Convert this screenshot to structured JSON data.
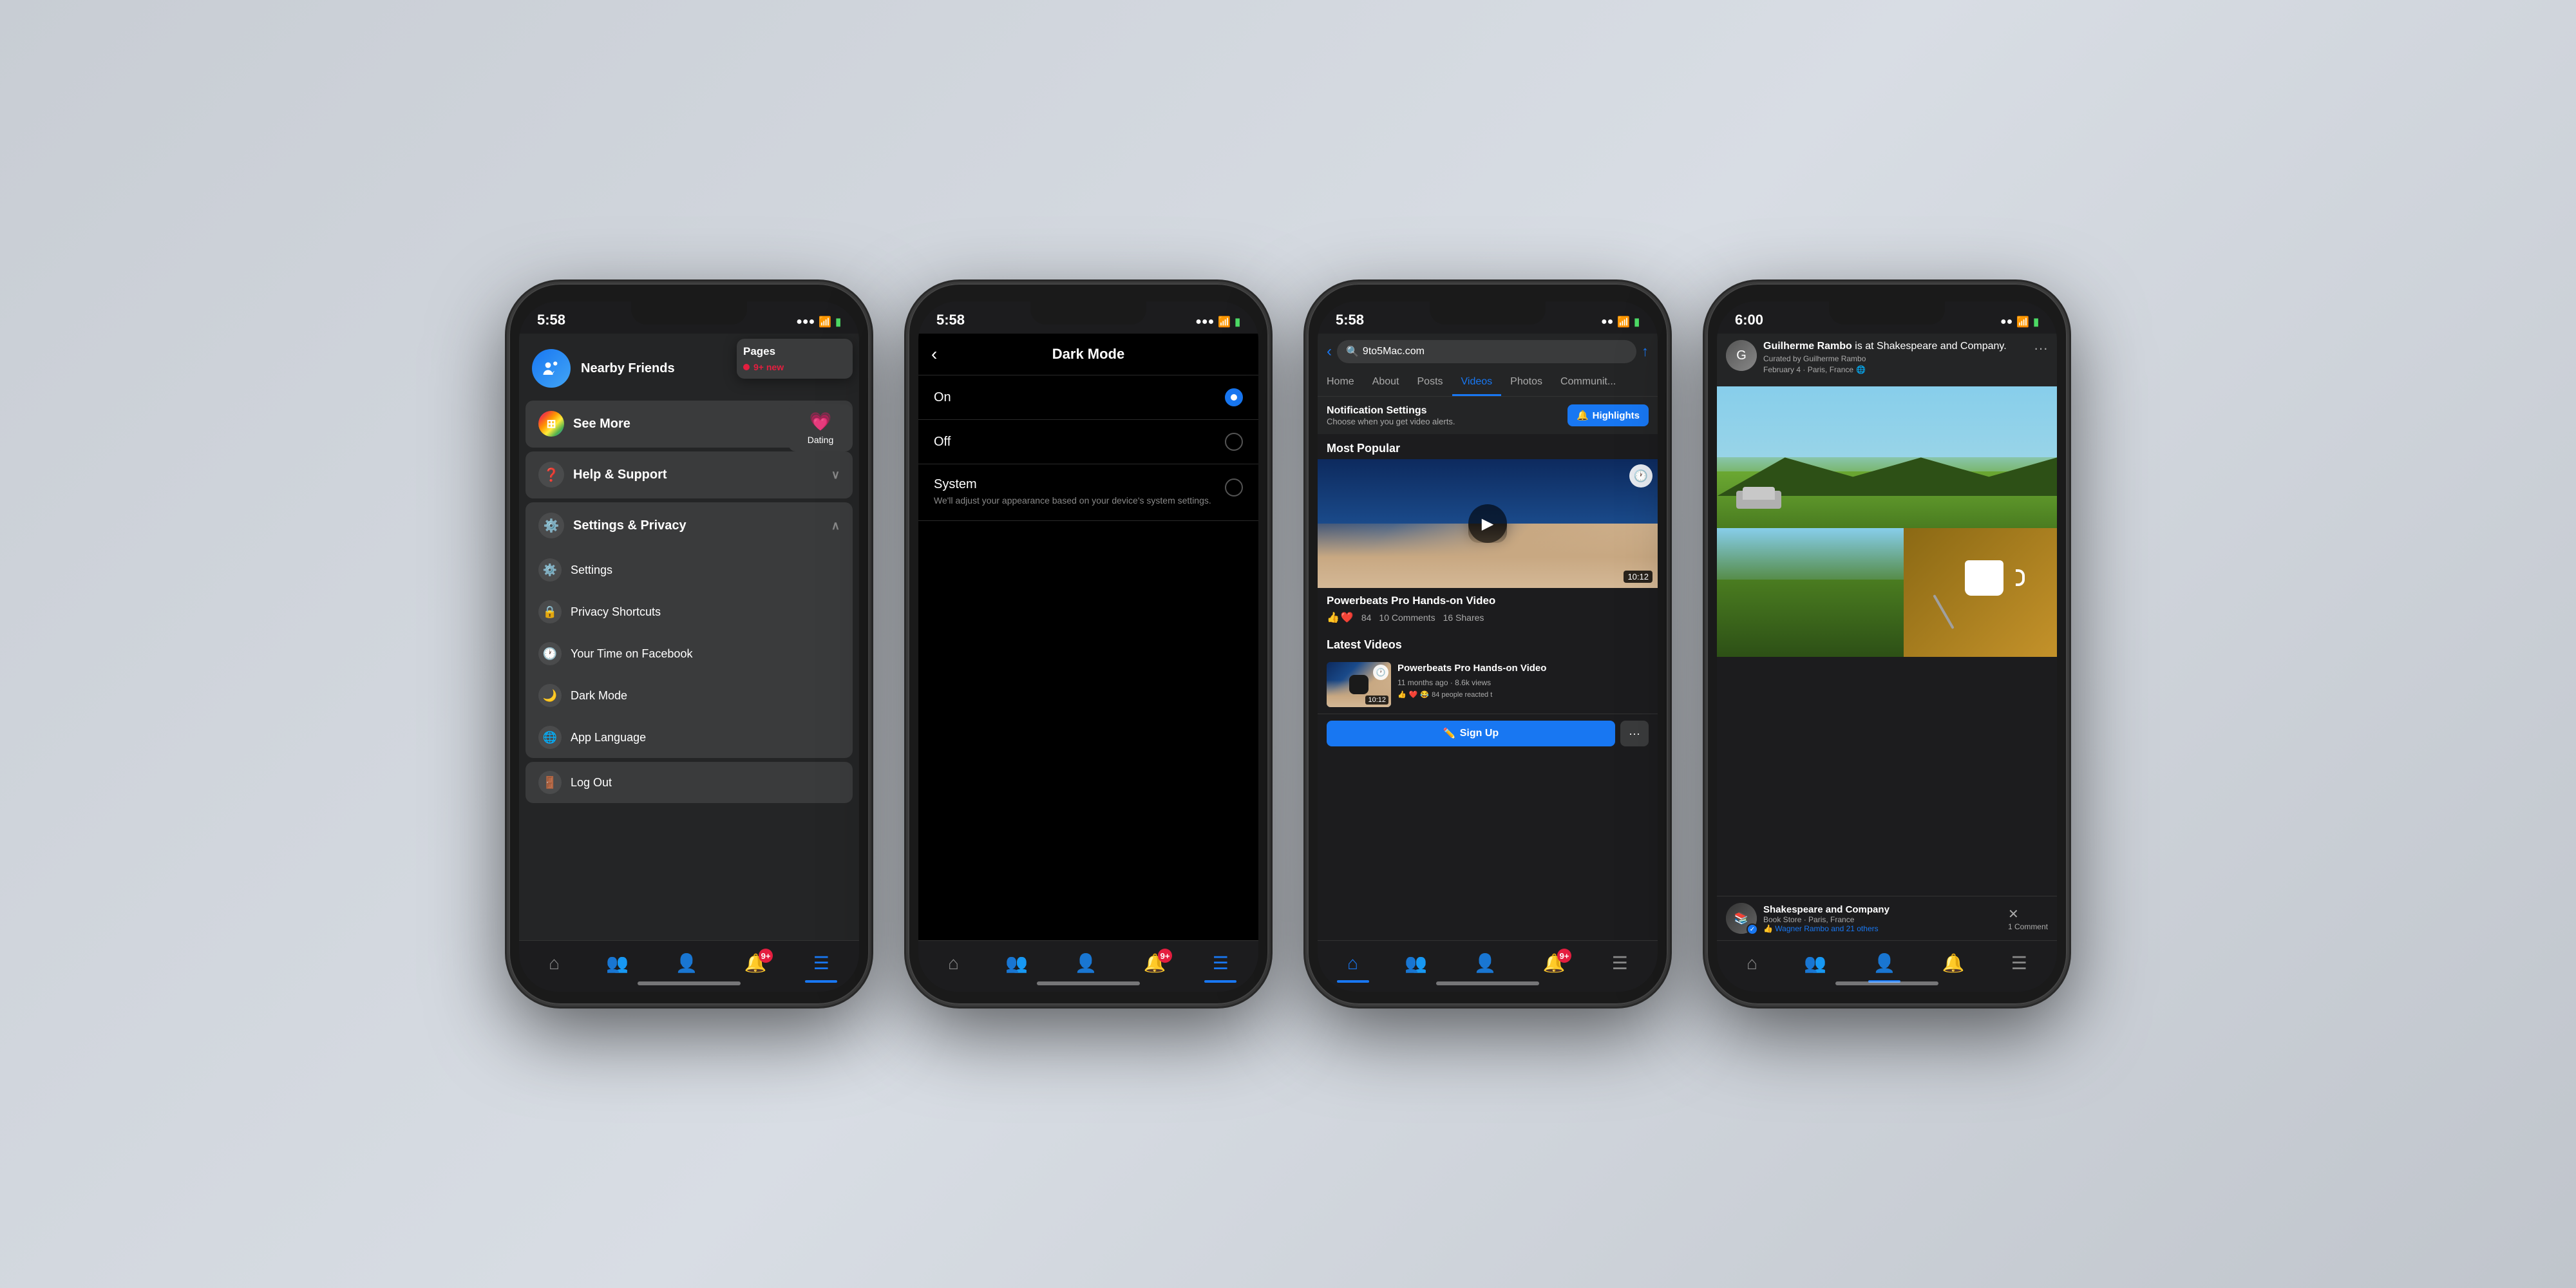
{
  "background": "#c8cdd4",
  "phones": [
    {
      "id": "phone1",
      "screen": "menu",
      "status": {
        "time": "5:58",
        "signal": "●●●",
        "wifi": "wifi",
        "battery": "🔋"
      },
      "popup_pages": {
        "title": "Pages",
        "badge": "9+ new"
      },
      "popup_dating": {
        "label": "Dating"
      },
      "nearby_friends": {
        "label": "Nearby Friends"
      },
      "sections": [
        {
          "id": "see-more",
          "label": "See More",
          "icon": "grid",
          "expandable": true,
          "expanded": false
        },
        {
          "id": "help-support",
          "label": "Help & Support",
          "icon": "question",
          "expandable": true,
          "expanded": false
        },
        {
          "id": "settings-privacy",
          "label": "Settings & Privacy",
          "icon": "gear",
          "expandable": true,
          "expanded": true,
          "children": [
            {
              "id": "settings",
              "label": "Settings",
              "icon": "gear-sm"
            },
            {
              "id": "privacy-shortcuts",
              "label": "Privacy Shortcuts",
              "icon": "lock"
            },
            {
              "id": "time-on-facebook",
              "label": "Your Time on Facebook",
              "icon": "clock"
            },
            {
              "id": "dark-mode",
              "label": "Dark Mode",
              "icon": "moon"
            },
            {
              "id": "app-language",
              "label": "App Language",
              "icon": "globe"
            }
          ]
        }
      ],
      "logout": {
        "label": "Log Out",
        "icon": "door"
      },
      "tabs": [
        {
          "id": "home",
          "icon": "🏠",
          "active": false
        },
        {
          "id": "friends",
          "icon": "👥",
          "active": false
        },
        {
          "id": "profile",
          "icon": "👤",
          "active": false
        },
        {
          "id": "notifications",
          "icon": "🔔",
          "active": false,
          "badge": "9+"
        },
        {
          "id": "menu",
          "icon": "☰",
          "active": true
        }
      ]
    },
    {
      "id": "phone2",
      "screen": "dark-mode",
      "status": {
        "time": "5:58",
        "signal": "●●●",
        "wifi": "wifi",
        "battery": "🔋"
      },
      "header": {
        "back_label": "‹",
        "title": "Dark Mode"
      },
      "options": [
        {
          "id": "on",
          "label": "On",
          "description": "",
          "selected": true
        },
        {
          "id": "off",
          "label": "Off",
          "description": "",
          "selected": false
        },
        {
          "id": "system",
          "label": "System",
          "description": "We'll adjust your appearance based on your device's system settings.",
          "selected": false
        }
      ],
      "tabs": [
        {
          "id": "home",
          "icon": "🏠",
          "active": false
        },
        {
          "id": "friends",
          "icon": "👥",
          "active": false
        },
        {
          "id": "profile",
          "icon": "👤",
          "active": false
        },
        {
          "id": "notifications",
          "icon": "🔔",
          "active": false,
          "badge": "9+"
        },
        {
          "id": "menu",
          "icon": "☰",
          "active": true
        }
      ]
    },
    {
      "id": "phone3",
      "screen": "videos",
      "status": {
        "time": "5:58",
        "signal": "●●",
        "wifi": "wifi",
        "battery": "🔋"
      },
      "header": {
        "back": "‹",
        "search_value": "9to5Mac.com",
        "share": "↑"
      },
      "tabs": [
        {
          "id": "home-tab",
          "label": "Home",
          "active": false
        },
        {
          "id": "about-tab",
          "label": "About",
          "active": false
        },
        {
          "id": "posts-tab",
          "label": "Posts",
          "active": false
        },
        {
          "id": "videos-tab",
          "label": "Videos",
          "active": true
        },
        {
          "id": "photos-tab",
          "label": "Photos",
          "active": false
        },
        {
          "id": "community-tab",
          "label": "Communit...",
          "active": false
        }
      ],
      "notification_settings": {
        "title": "Notification Settings",
        "subtitle": "Choose when you get video alerts.",
        "highlights_label": "Highlights",
        "highlights_icon": "🔔"
      },
      "most_popular": {
        "section_title": "Most Popular",
        "video": {
          "title": "Powerbeats Pro Hands-on Video",
          "duration": "10:12",
          "likes": "84",
          "comments": "10 Comments",
          "shares": "16 Shares"
        }
      },
      "latest_videos": {
        "section_title": "Latest Videos",
        "items": [
          {
            "title": "Powerbeats Pro Hands-on Video",
            "meta": "11 months ago · 8.6k views",
            "reactions": "84 people reacted t",
            "duration": "10:12"
          }
        ]
      },
      "sign_up_label": "Sign Up",
      "bottom_tabs": [
        {
          "id": "home",
          "icon": "🏠",
          "active": true
        },
        {
          "id": "friends",
          "icon": "👥",
          "active": false
        },
        {
          "id": "profile",
          "icon": "👤",
          "active": false
        },
        {
          "id": "notifications",
          "icon": "🔔",
          "active": false,
          "badge": "9+"
        },
        {
          "id": "menu",
          "icon": "☰",
          "active": false
        }
      ]
    },
    {
      "id": "phone4",
      "screen": "profile-post",
      "status": {
        "time": "6:00",
        "signal": "●●",
        "wifi": "wifi",
        "battery": "🔋"
      },
      "post": {
        "author": "Guilherme Rambo",
        "at_location": "is at Shakespeare and Company.",
        "meta": "Curated by Guilherme Rambo",
        "date": "February 4 · Paris, France",
        "location_card": {
          "name": "Shakespeare and Company",
          "type": "Book Store · Paris, France",
          "reactions": "Wagner Rambo and 21 others",
          "comments": "1 Comment"
        }
      },
      "tabs": [
        {
          "id": "home",
          "icon": "🏠",
          "active": false
        },
        {
          "id": "friends",
          "icon": "👥",
          "active": false
        },
        {
          "id": "profile",
          "icon": "👤",
          "active": true
        },
        {
          "id": "notifications",
          "icon": "🔔",
          "active": false
        },
        {
          "id": "menu",
          "icon": "☰",
          "active": false
        }
      ]
    }
  ]
}
